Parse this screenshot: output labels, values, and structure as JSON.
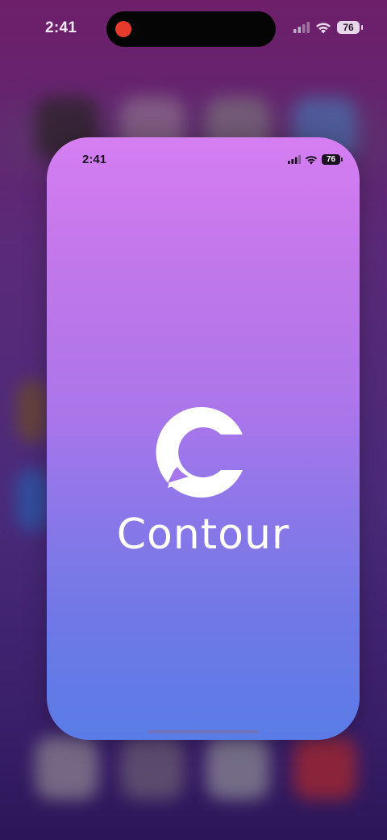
{
  "system_status": {
    "time": "2:41",
    "battery": "76",
    "recording_indicator_color": "#e53a2c"
  },
  "app_preview": {
    "status_time": "2:41",
    "status_battery": "76",
    "app_name": "Contour",
    "logo_icon": "contour-chat-bubble-icon",
    "gradient_top": "#d57ef2",
    "gradient_bottom": "#5a7ce6"
  }
}
